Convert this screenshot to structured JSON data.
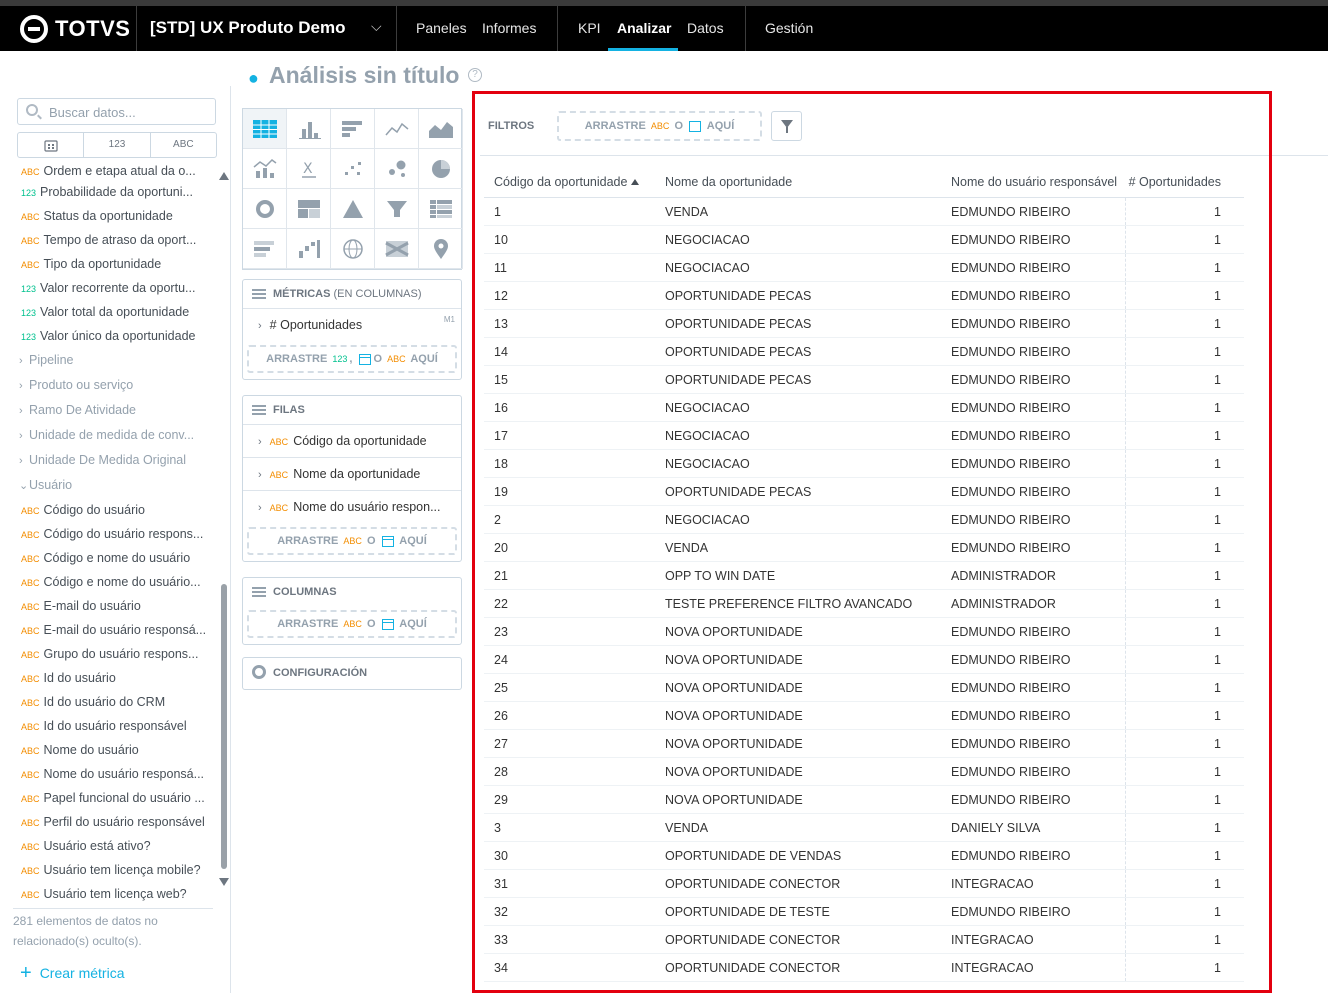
{
  "header": {
    "brand": "TOTVS",
    "project": "[STD] UX Produto Demo",
    "nav": [
      {
        "label": "Paneles"
      },
      {
        "label": "Informes"
      },
      {
        "label": "KPI"
      },
      {
        "label": "Analizar",
        "active": true
      },
      {
        "label": "Datos"
      },
      {
        "label": "Gestión"
      }
    ],
    "accent_color": "#14b2e2"
  },
  "page_title": "Análisis sin título",
  "catalog": {
    "search_placeholder": "Buscar datos...",
    "type_tabs": [
      "123",
      "ABC"
    ],
    "items": [
      {
        "type": "ABC",
        "label": "Ordem e etapa atual da o..."
      },
      {
        "type": "123",
        "label": "Probabilidade da oportuni..."
      },
      {
        "type": "ABC",
        "label": "Status da oportunidade"
      },
      {
        "type": "ABC",
        "label": "Tempo de atraso da oport..."
      },
      {
        "type": "ABC",
        "label": "Tipo da oportunidade"
      },
      {
        "type": "123",
        "label": "Valor recorrente da oportu..."
      },
      {
        "type": "123",
        "label": "Valor total da oportunidade"
      },
      {
        "type": "123",
        "label": "Valor único da oportunidade"
      }
    ],
    "folders": [
      "Pipeline",
      "Produto ou serviço",
      "Ramo De Atividade",
      "Unidade de medida de conv...",
      "Unidade De Medida Original"
    ],
    "open_folder": "Usuário",
    "user_items": [
      "Código do usuário",
      "Código do usuário respons...",
      "Código e nome do usuário",
      "Código e nome do usuário...",
      "E-mail do usuário",
      "E-mail do usuário responsá...",
      "Grupo do usuário respons...",
      "Id do usuário",
      "Id do usuário do CRM",
      "Id do usuário responsável",
      "Nome do usuário",
      "Nome do usuário responsá...",
      "Papel funcional do usuário ...",
      "Perfil do usuário responsável",
      "Usuário está ativo?",
      "Usuário tem licença mobile?",
      "Usuário tem licença web?"
    ],
    "hidden_info": "281 elementos de datos no relacionado(s) oculto(s).",
    "create_metric": "Crear métrica"
  },
  "config": {
    "metrics_title": "MÉTRICAS",
    "metrics_subtitle": "(EN COLUMNAS)",
    "metric_item": "# Oportunidades",
    "metric_tag": "M1",
    "drag_word": "ARRASTRE",
    "or_word": "O",
    "here_word": "AQUÍ",
    "rows_title": "FILAS",
    "row_items": [
      "Código da oportunidade",
      "Nome da oportunidade",
      "Nome do usuário respon..."
    ],
    "columns_title": "COLUMNAS",
    "settings_title": "CONFIGURACIÓN"
  },
  "filters": {
    "label": "FILTROS",
    "drag_word": "ARRASTRE",
    "or_word": "O",
    "here_word": "AQUÍ"
  },
  "table": {
    "headers": [
      "Código da oportunidade",
      "Nome da oportunidade",
      "Nome do usuário responsável",
      "# Oportunidades"
    ],
    "rows": [
      [
        "1",
        "VENDA",
        "EDMUNDO RIBEIRO",
        "1"
      ],
      [
        "10",
        "NEGOCIACAO",
        "EDMUNDO RIBEIRO",
        "1"
      ],
      [
        "11",
        "NEGOCIACAO",
        "EDMUNDO RIBEIRO",
        "1"
      ],
      [
        "12",
        "OPORTUNIDADE PECAS",
        "EDMUNDO RIBEIRO",
        "1"
      ],
      [
        "13",
        "OPORTUNIDADE PECAS",
        "EDMUNDO RIBEIRO",
        "1"
      ],
      [
        "14",
        "OPORTUNIDADE PECAS",
        "EDMUNDO RIBEIRO",
        "1"
      ],
      [
        "15",
        "OPORTUNIDADE PECAS",
        "EDMUNDO RIBEIRO",
        "1"
      ],
      [
        "16",
        "NEGOCIACAO",
        "EDMUNDO RIBEIRO",
        "1"
      ],
      [
        "17",
        "NEGOCIACAO",
        "EDMUNDO RIBEIRO",
        "1"
      ],
      [
        "18",
        "NEGOCIACAO",
        "EDMUNDO RIBEIRO",
        "1"
      ],
      [
        "19",
        "OPORTUNIDADE PECAS",
        "EDMUNDO RIBEIRO",
        "1"
      ],
      [
        "2",
        "NEGOCIACAO",
        "EDMUNDO RIBEIRO",
        "1"
      ],
      [
        "20",
        "VENDA",
        "EDMUNDO RIBEIRO",
        "1"
      ],
      [
        "21",
        "OPP TO WIN DATE",
        "ADMINISTRADOR",
        "1"
      ],
      [
        "22",
        "TESTE PREFERENCE FILTRO AVANCADO",
        "ADMINISTRADOR",
        "1"
      ],
      [
        "23",
        "NOVA OPORTUNIDADE",
        "EDMUNDO RIBEIRO",
        "1"
      ],
      [
        "24",
        "NOVA OPORTUNIDADE",
        "EDMUNDO RIBEIRO",
        "1"
      ],
      [
        "25",
        "NOVA OPORTUNIDADE",
        "EDMUNDO RIBEIRO",
        "1"
      ],
      [
        "26",
        "NOVA OPORTUNIDADE",
        "EDMUNDO RIBEIRO",
        "1"
      ],
      [
        "27",
        "NOVA OPORTUNIDADE",
        "EDMUNDO RIBEIRO",
        "1"
      ],
      [
        "28",
        "NOVA OPORTUNIDADE",
        "EDMUNDO RIBEIRO",
        "1"
      ],
      [
        "29",
        "NOVA OPORTUNIDADE",
        "EDMUNDO RIBEIRO",
        "1"
      ],
      [
        "3",
        "VENDA",
        "DANIELY SILVA",
        "1"
      ],
      [
        "30",
        "OPORTUNIDADE DE VENDAS",
        "EDMUNDO RIBEIRO",
        "1"
      ],
      [
        "31",
        "OPORTUNIDADE CONECTOR",
        "INTEGRACAO",
        "1"
      ],
      [
        "32",
        "OPORTUNIDADE DE TESTE",
        "EDMUNDO RIBEIRO",
        "1"
      ],
      [
        "33",
        "OPORTUNIDADE CONECTOR",
        "INTEGRACAO",
        "1"
      ],
      [
        "34",
        "OPORTUNIDADE CONECTOR",
        "INTEGRACAO",
        "1"
      ]
    ]
  },
  "highlight_color": "#e3000f"
}
